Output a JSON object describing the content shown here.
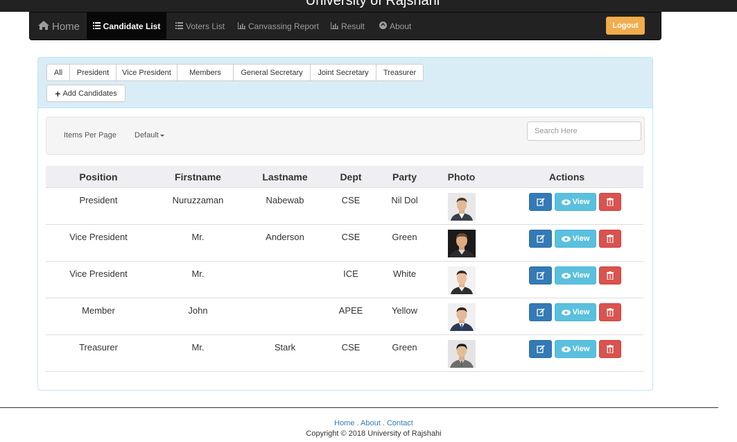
{
  "site": {
    "title": "University of Rajshahi"
  },
  "nav": {
    "home": "Home",
    "candidate_list": "Candidate List",
    "voters_list": "Voters List",
    "canvassing_report": "Canvassing Report",
    "result": "Result",
    "about": "About",
    "logout": "Logout"
  },
  "filters": [
    "All",
    "President",
    "Vice President",
    "Members",
    "General Secretary",
    "Joint Secretary",
    "Treasurer"
  ],
  "add_button": "Add Candidates",
  "toolbar": {
    "items_per_page": "Items Per Page",
    "select_value": "Default",
    "search_placeholder": "Search Here"
  },
  "table": {
    "headers": {
      "position": "Position",
      "firstname": "Firstname",
      "lastname": "Lastname",
      "dept": "Dept",
      "party": "Party",
      "photo": "Photo",
      "actions": "Actions"
    },
    "rows": [
      {
        "position": "President",
        "firstname": "Nuruzzaman",
        "lastname": "Nabewab",
        "dept": "CSE",
        "party": "Nil Dol"
      },
      {
        "position": "Vice President",
        "firstname": "Mr.",
        "lastname": "Anderson",
        "dept": "CSE",
        "party": "Green"
      },
      {
        "position": "Vice President",
        "firstname": "Mr.",
        "lastname": "",
        "dept": "ICE",
        "party": "White"
      },
      {
        "position": "Member",
        "firstname": "John",
        "lastname": "",
        "dept": "APEE",
        "party": "Yellow"
      },
      {
        "position": "Treasurer",
        "firstname": "Mr.",
        "lastname": "Stark",
        "dept": "CSE",
        "party": "Green"
      }
    ],
    "view_label": "View"
  },
  "footer": {
    "home": "Home",
    "about": "About",
    "contact": "Contact",
    "copyright": "Copyright © 2018 University of Rajshahi"
  },
  "colors": {
    "navbar": "#222222",
    "panel_heading": "#d9edf7",
    "logout": "#f0ad4e",
    "edit": "#337ab7",
    "view": "#5bc0de",
    "delete": "#d9534f"
  }
}
